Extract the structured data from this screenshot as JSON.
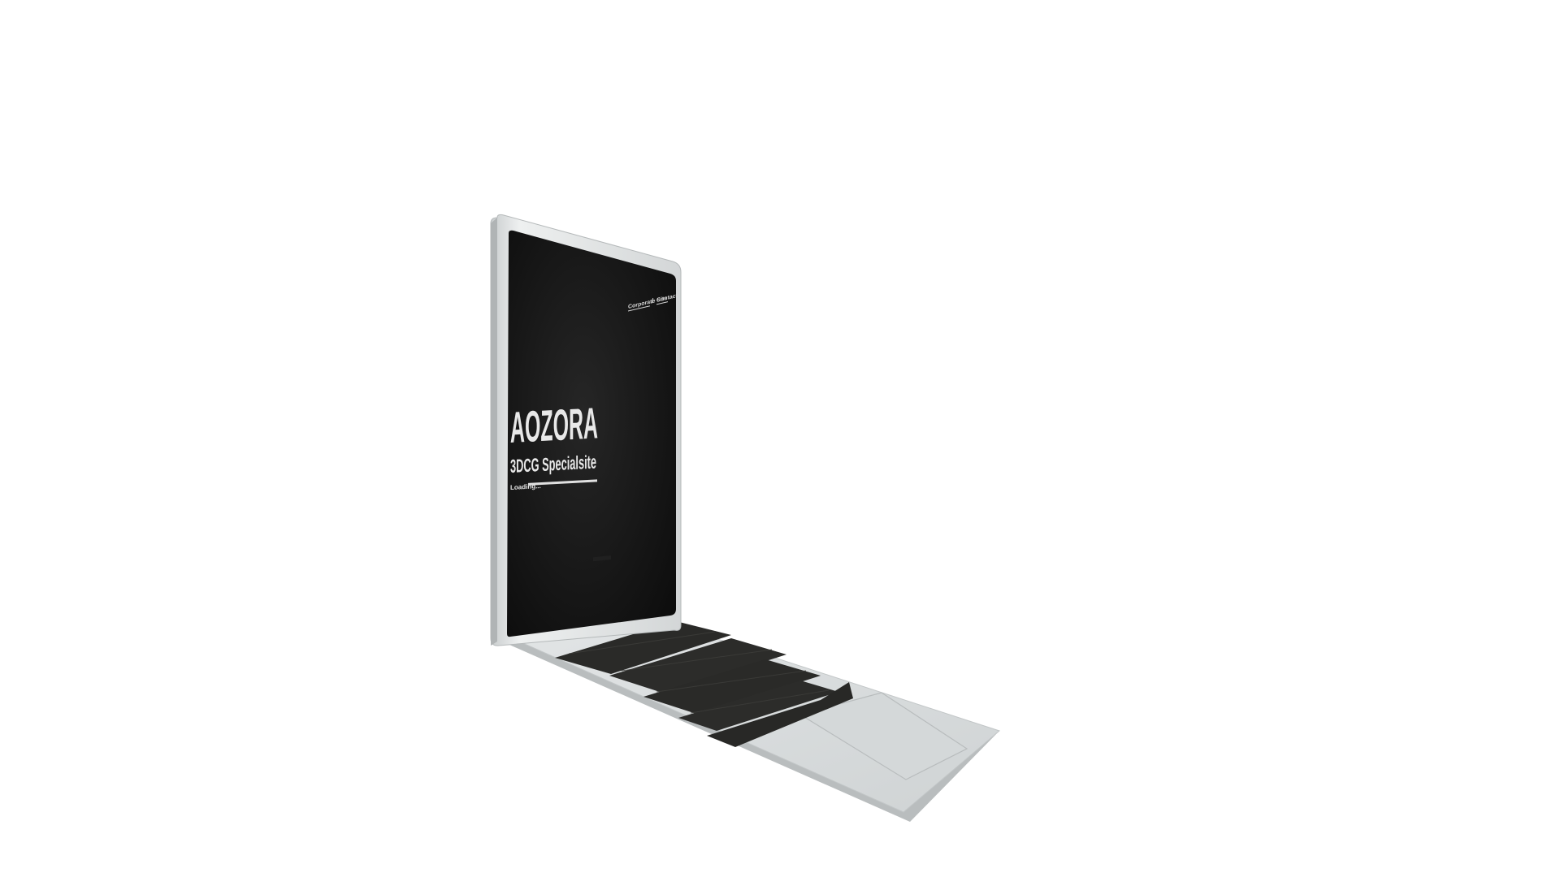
{
  "screen": {
    "nav": {
      "corporate_label": "Corporate Site",
      "separator": "/",
      "contact_label": "Contact"
    },
    "brand_title": "AOZORA",
    "brand_subtitle": "3DCG Specialsite",
    "loading_label": "Loading...",
    "loading_progress_percent": 100
  },
  "colors": {
    "background": "#ffffff",
    "screen_background": "#141414",
    "laptop_body": "#d6dadb",
    "keys": "#2a2a28",
    "screen_text": "#e8e8e8"
  },
  "icons": {
    "hinge_logo": "laptop-hinge-logo-icon"
  }
}
